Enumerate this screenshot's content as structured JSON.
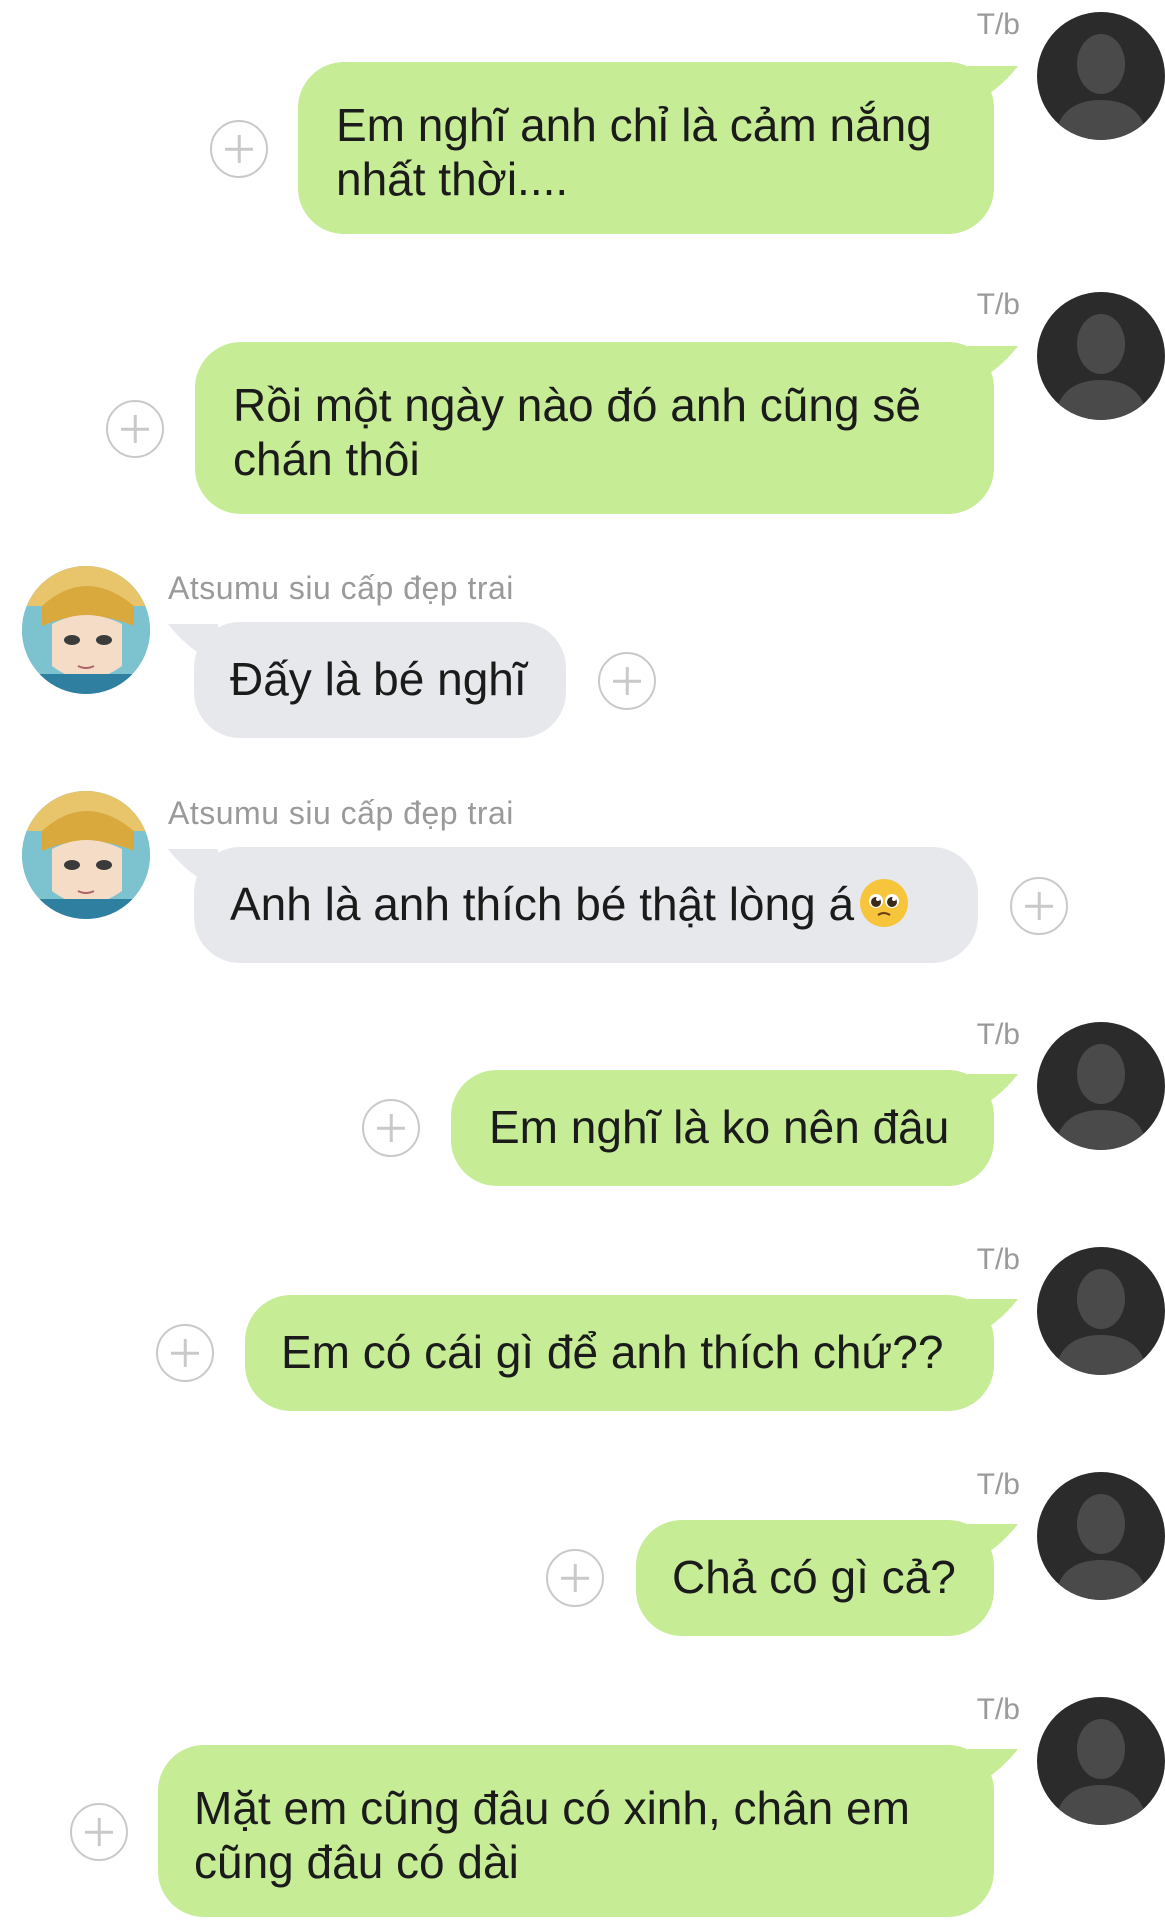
{
  "self_name": "T/b",
  "other_name": "Atsumu siu cấp đẹp trai",
  "colors": {
    "outgoing_bubble": "#c6ec96",
    "incoming_bubble": "#e6e8ec",
    "name_text": "#9a9a9a",
    "add_reaction_icon": "#c9c9c9"
  },
  "messages": [
    {
      "sender": "self",
      "name": "T/b",
      "text": "Em nghĩ anh chỉ là cảm nắng nhất thời...."
    },
    {
      "sender": "self",
      "name": "T/b",
      "text": "Rồi một ngày nào đó anh cũng sẽ chán thôi"
    },
    {
      "sender": "other",
      "name": "Atsumu siu cấp đẹp trai",
      "text": "Đấy là bé nghĩ"
    },
    {
      "sender": "other",
      "name": "Atsumu siu cấp đẹp trai",
      "text": "Anh là anh thích bé thật lòng á",
      "emoji": "pleading-face-emoji"
    },
    {
      "sender": "self",
      "name": "T/b",
      "text": "Em nghĩ là ko nên đâu"
    },
    {
      "sender": "self",
      "name": "T/b",
      "text": "Em có cái gì để anh thích chứ??"
    },
    {
      "sender": "self",
      "name": "T/b",
      "text": "Chả có gì cả?"
    },
    {
      "sender": "self",
      "name": "T/b",
      "text": "Mặt em cũng đâu có xinh, chân em cũng đâu có dài"
    }
  ]
}
